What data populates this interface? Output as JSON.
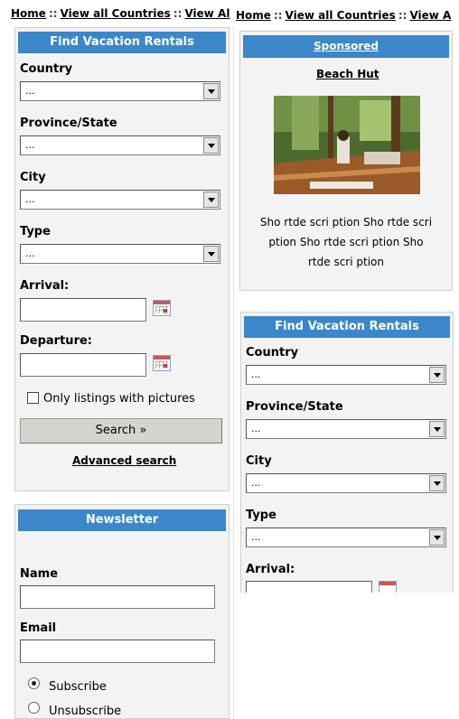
{
  "breadcrumb_left": {
    "home": "Home",
    "sep1": "::",
    "all_countries": "View all Countries",
    "sep2": "::",
    "view_partial": "View Al"
  },
  "breadcrumb_right": {
    "home": "Home",
    "sep1": "::",
    "all_countries": "View all Countries",
    "sep2": "::",
    "view_partial": "View A"
  },
  "search_left": {
    "title": "Find Vacation Rentals",
    "country_label": "Country",
    "country_value": "...",
    "province_label": "Province/State",
    "province_value": "...",
    "city_label": "City",
    "city_value": "...",
    "type_label": "Type",
    "type_value": "...",
    "arrival_label": "Arrival:",
    "arrival_value": "",
    "departure_label": "Departure:",
    "departure_value": "",
    "pictures_label": "Only listings with pictures",
    "search_button": "Search »",
    "advanced_link": "Advanced search"
  },
  "newsletter": {
    "title": "Newsletter",
    "name_label": "Name",
    "name_value": "",
    "email_label": "Email",
    "email_value": "",
    "subscribe_label": "Subscribe",
    "unsubscribe_label": "Unsubscribe"
  },
  "sponsored": {
    "title": "Sponsored",
    "listing_title": "Beach Hut",
    "description_lines": [
      "Sho rtde scri ption Sho rtde scri",
      "ption Sho rtde scri ption Sho",
      "rtde scri ption"
    ]
  },
  "search_right": {
    "title": "Find Vacation Rentals",
    "country_label": "Country",
    "country_value": "...",
    "province_label": "Province/State",
    "province_value": "...",
    "city_label": "City",
    "city_value": "...",
    "type_label": "Type",
    "type_value": "...",
    "arrival_label": "Arrival:"
  },
  "colors": {
    "header_blue": "#3b87c9",
    "panel_bg": "#f3f3f3",
    "button_gray": "#d6d4cf"
  }
}
